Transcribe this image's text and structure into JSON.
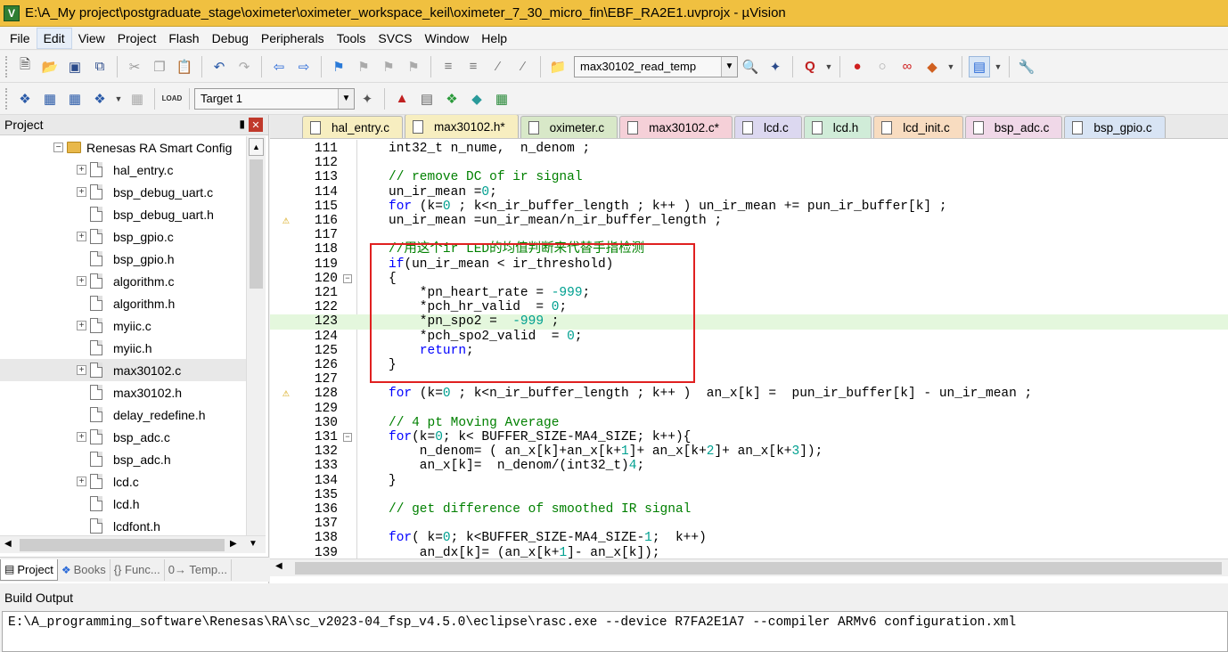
{
  "window": {
    "title": "E:\\A_My project\\postgraduate_stage\\oximeter\\oximeter_workspace_keil\\oximeter_7_30_micro_fin\\EBF_RA2E1.uvprojx - µVision",
    "icon_label": "V"
  },
  "menu": [
    "File",
    "Edit",
    "View",
    "Project",
    "Flash",
    "Debug",
    "Peripherals",
    "Tools",
    "SVCS",
    "Window",
    "Help"
  ],
  "toolbar1": {
    "find_combo_value": "max30102_read_temp"
  },
  "toolbar2": {
    "target_combo_value": "Target 1"
  },
  "project_panel": {
    "title": "Project",
    "root": "Renesas RA Smart Config",
    "files": [
      {
        "name": "hal_entry.c",
        "expandable": true
      },
      {
        "name": "bsp_debug_uart.c",
        "expandable": true
      },
      {
        "name": "bsp_debug_uart.h",
        "expandable": false
      },
      {
        "name": "bsp_gpio.c",
        "expandable": true
      },
      {
        "name": "bsp_gpio.h",
        "expandable": false
      },
      {
        "name": "algorithm.c",
        "expandable": true
      },
      {
        "name": "algorithm.h",
        "expandable": false
      },
      {
        "name": "myiic.c",
        "expandable": true
      },
      {
        "name": "myiic.h",
        "expandable": false
      },
      {
        "name": "max30102.c",
        "expandable": true,
        "selected": true
      },
      {
        "name": "max30102.h",
        "expandable": false
      },
      {
        "name": "delay_redefine.h",
        "expandable": false
      },
      {
        "name": "bsp_adc.c",
        "expandable": true
      },
      {
        "name": "bsp_adc.h",
        "expandable": false
      },
      {
        "name": "lcd.c",
        "expandable": true
      },
      {
        "name": "lcd.h",
        "expandable": false
      },
      {
        "name": "lcdfont.h",
        "expandable": false
      }
    ],
    "tabs": [
      "Project",
      "Books",
      "{} Func...",
      "0→ Temp..."
    ]
  },
  "editor_tabs": [
    {
      "label": "hal_entry.c",
      "color": "#f7eec0"
    },
    {
      "label": "max30102.h*",
      "color": "#f7eec0",
      "active": true
    },
    {
      "label": "oximeter.c",
      "color": "#d8e8c8"
    },
    {
      "label": "max30102.c*",
      "color": "#f5d0d8"
    },
    {
      "label": "lcd.c",
      "color": "#dcd8f0"
    },
    {
      "label": "lcd.h",
      "color": "#d0ecd8"
    },
    {
      "label": "lcd_init.c",
      "color": "#f8dcc0"
    },
    {
      "label": "bsp_adc.c",
      "color": "#f0d8e8"
    },
    {
      "label": "bsp_gpio.c",
      "color": "#d8e4f4"
    }
  ],
  "code_lines": [
    {
      "n": "111",
      "text": "int32_t n_nume,  n_denom ;"
    },
    {
      "n": "112",
      "text": ""
    },
    {
      "n": "113",
      "text": "// remove DC of ir signal",
      "type": "comment"
    },
    {
      "n": "114",
      "text": "un_ir_mean =0;"
    },
    {
      "n": "115",
      "text": "for (k=0 ; k<n_ir_buffer_length ; k++ ) un_ir_mean += pun_ir_buffer[k] ;"
    },
    {
      "n": "116",
      "text": "un_ir_mean =un_ir_mean/n_ir_buffer_length ;",
      "warn": true
    },
    {
      "n": "117",
      "text": ""
    },
    {
      "n": "118",
      "text": "//用这个ir LED的均值判断来代替手指检测",
      "type": "comment"
    },
    {
      "n": "119",
      "text": "if(un_ir_mean < ir_threshold)"
    },
    {
      "n": "120",
      "text": "{",
      "fold": true
    },
    {
      "n": "121",
      "text": "    *pn_heart_rate = -999;"
    },
    {
      "n": "122",
      "text": "    *pch_hr_valid  = 0;"
    },
    {
      "n": "123",
      "text": "    *pn_spo2 =  -999 ;",
      "highlight": true
    },
    {
      "n": "124",
      "text": "    *pch_spo2_valid  = 0;"
    },
    {
      "n": "125",
      "text": "    return;"
    },
    {
      "n": "126",
      "text": "}"
    },
    {
      "n": "127",
      "text": ""
    },
    {
      "n": "128",
      "text": "for (k=0 ; k<n_ir_buffer_length ; k++ )  an_x[k] =  pun_ir_buffer[k] - un_ir_mean ;",
      "warn": true
    },
    {
      "n": "129",
      "text": ""
    },
    {
      "n": "130",
      "text": "// 4 pt Moving Average",
      "type": "comment"
    },
    {
      "n": "131",
      "text": "for(k=0; k< BUFFER_SIZE-MA4_SIZE; k++){",
      "fold": true
    },
    {
      "n": "132",
      "text": "    n_denom= ( an_x[k]+an_x[k+1]+ an_x[k+2]+ an_x[k+3]);"
    },
    {
      "n": "133",
      "text": "    an_x[k]=  n_denom/(int32_t)4;"
    },
    {
      "n": "134",
      "text": "}"
    },
    {
      "n": "135",
      "text": ""
    },
    {
      "n": "136",
      "text": "// get difference of smoothed IR signal",
      "type": "comment"
    },
    {
      "n": "137",
      "text": ""
    },
    {
      "n": "138",
      "text": "for( k=0; k<BUFFER_SIZE-MA4_SIZE-1;  k++)"
    },
    {
      "n": "139",
      "text": "    an_dx[k]= (an_x[k+1]- an_x[k]);"
    }
  ],
  "build_output": {
    "title": "Build Output",
    "text": "E:\\A_programming_software\\Renesas\\RA\\sc_v2023-04_fsp_v4.5.0\\eclipse\\rasc.exe --device R7FA2E1A7 --compiler ARMv6 configuration.xml"
  }
}
